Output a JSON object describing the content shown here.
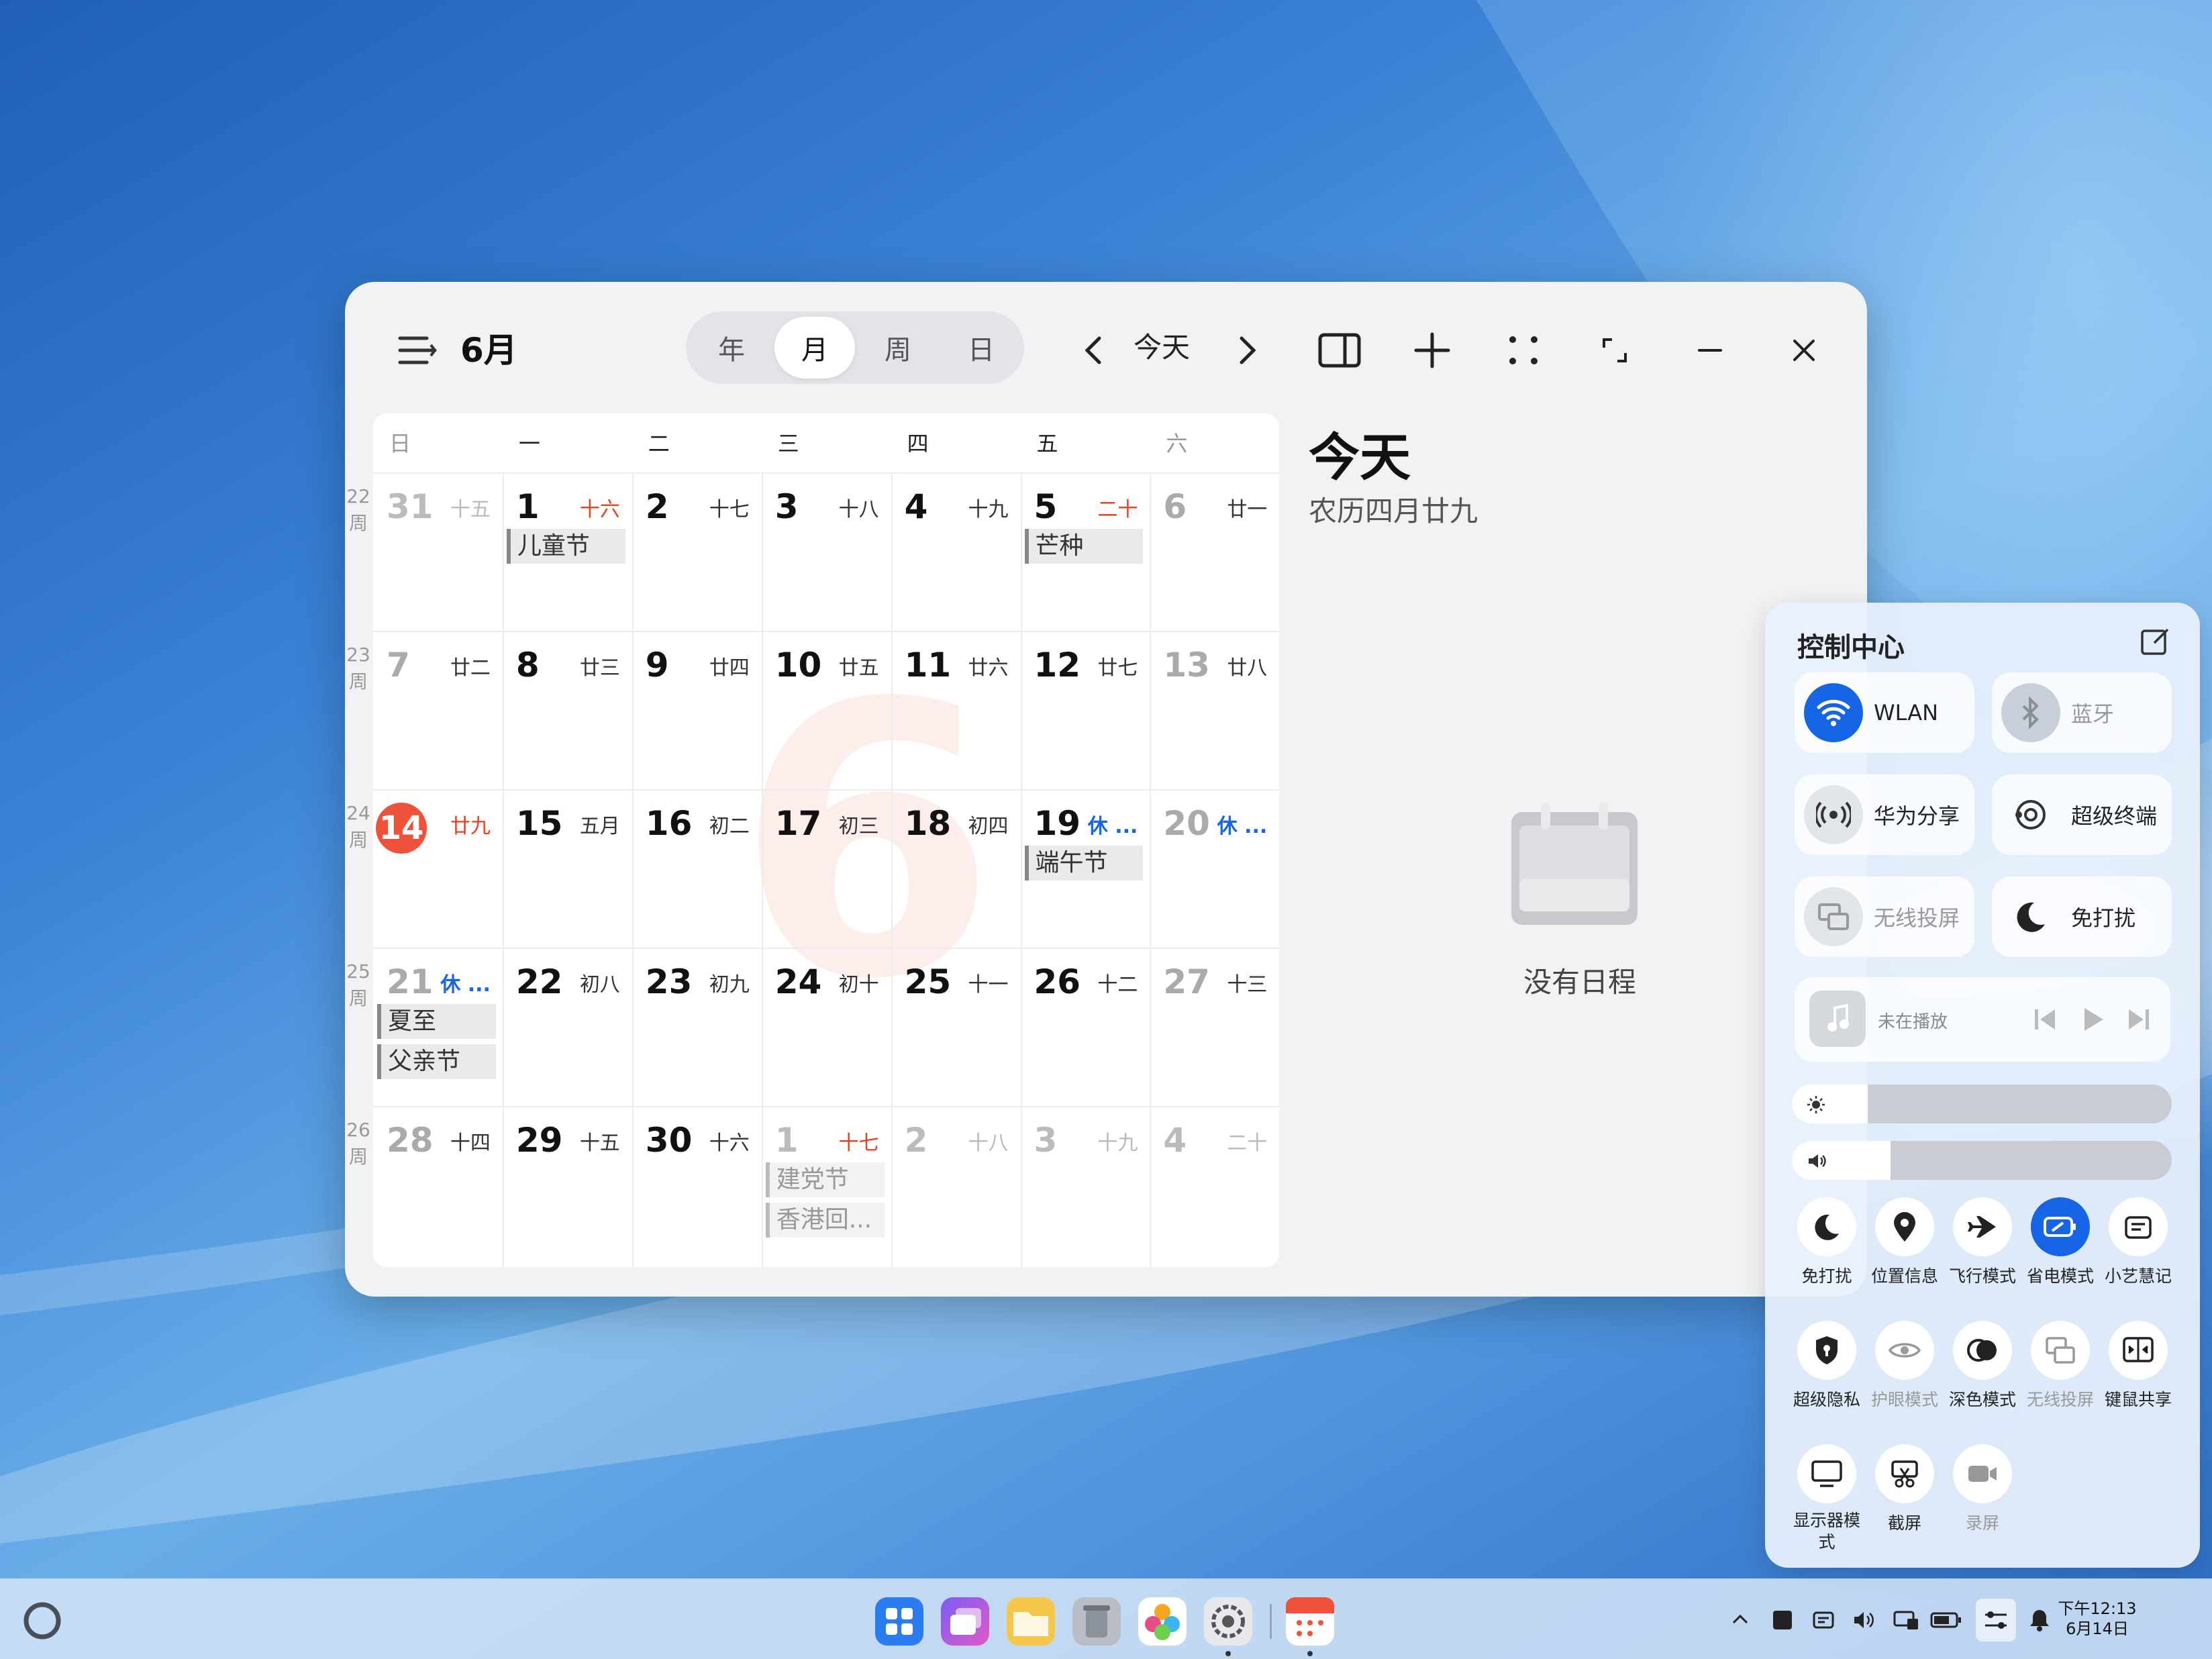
{
  "window": {
    "month_label": "6月",
    "view_tabs": [
      "年",
      "月",
      "周",
      "日"
    ],
    "active_view": "月",
    "today_button": "今天"
  },
  "weekday_headers": [
    "日",
    "一",
    "二",
    "三",
    "四",
    "五",
    "六"
  ],
  "week_numbers": [
    [
      "22",
      "周"
    ],
    [
      "23",
      "周"
    ],
    [
      "24",
      "周"
    ],
    [
      "25",
      "周"
    ],
    [
      "26",
      "周"
    ]
  ],
  "weeks": [
    [
      {
        "d": "31",
        "l": "十五",
        "dim": true
      },
      {
        "d": "1",
        "l": "十六",
        "lc": "red"
      },
      {
        "d": "2",
        "l": "十七"
      },
      {
        "d": "3",
        "l": "十八"
      },
      {
        "d": "4",
        "l": "十九"
      },
      {
        "d": "5",
        "l": "二十",
        "lc": "red"
      },
      {
        "d": "6",
        "l": "廿一",
        "weekend": true
      }
    ],
    [
      {
        "d": "7",
        "l": "廿二",
        "weekend": true
      },
      {
        "d": "8",
        "l": "廿三"
      },
      {
        "d": "9",
        "l": "廿四"
      },
      {
        "d": "10",
        "l": "廿五"
      },
      {
        "d": "11",
        "l": "廿六"
      },
      {
        "d": "12",
        "l": "廿七"
      },
      {
        "d": "13",
        "l": "廿八",
        "weekend": true
      }
    ],
    [
      {
        "d": "14",
        "l": "廿九",
        "lc": "red",
        "today": true
      },
      {
        "d": "15",
        "l": "五月"
      },
      {
        "d": "16",
        "l": "初二"
      },
      {
        "d": "17",
        "l": "初三"
      },
      {
        "d": "18",
        "l": "初四"
      },
      {
        "d": "19",
        "l": "休 ...",
        "lc": "blue"
      },
      {
        "d": "20",
        "l": "休 ...",
        "lc": "blue",
        "weekend": true
      }
    ],
    [
      {
        "d": "21",
        "l": "休 ...",
        "lc": "blue",
        "weekend": true
      },
      {
        "d": "22",
        "l": "初八"
      },
      {
        "d": "23",
        "l": "初九"
      },
      {
        "d": "24",
        "l": "初十"
      },
      {
        "d": "25",
        "l": "十一"
      },
      {
        "d": "26",
        "l": "十二"
      },
      {
        "d": "27",
        "l": "十三",
        "weekend": true
      }
    ],
    [
      {
        "d": "28",
        "l": "十四",
        "weekend": true
      },
      {
        "d": "29",
        "l": "十五"
      },
      {
        "d": "30",
        "l": "十六"
      },
      {
        "d": "1",
        "l": "十七",
        "lc": "red",
        "dim": true
      },
      {
        "d": "2",
        "l": "十八",
        "dim": true
      },
      {
        "d": "3",
        "l": "十九",
        "dim": true
      },
      {
        "d": "4",
        "l": "二十",
        "dim": true
      }
    ]
  ],
  "events": [
    {
      "week": 0,
      "col": 1,
      "slot": 0,
      "title": "儿童节"
    },
    {
      "week": 0,
      "col": 5,
      "slot": 0,
      "title": "芒种"
    },
    {
      "week": 2,
      "col": 5,
      "slot": 0,
      "title": "端午节"
    },
    {
      "week": 3,
      "col": 0,
      "slot": 0,
      "title": "夏至"
    },
    {
      "week": 3,
      "col": 0,
      "slot": 1,
      "title": "父亲节"
    },
    {
      "week": 4,
      "col": 3,
      "slot": 0,
      "title": "建党节",
      "dim": true
    },
    {
      "week": 4,
      "col": 3,
      "slot": 1,
      "title": "香港回...",
      "dim": true
    }
  ],
  "month_watermark": "6",
  "panel": {
    "title": "今天",
    "lunar_date": "农历四月廿九",
    "empty_text": "没有日程"
  },
  "control_center": {
    "title": "控制中心",
    "tiles": [
      "WLAN",
      "蓝牙",
      "华为分享",
      "超级终端",
      "无线投屏",
      "免打扰"
    ],
    "media": {
      "status": "未在播放"
    },
    "brightness": 0.2,
    "volume": 0.26,
    "quick_row1": [
      "免打扰",
      "位置信息",
      "飞行模式",
      "省电模式",
      "小艺慧记"
    ],
    "quick_row2": [
      "超级隐私",
      "护眼模式",
      "深色模式",
      "无线投屏",
      "键鼠共享"
    ],
    "quick_row3": [
      "显示器模式",
      "截屏",
      "录屏"
    ]
  },
  "taskbar": {
    "time": "下午12:13",
    "date": "6月14日"
  },
  "colors": {
    "accent": "#1565e6",
    "today": "#f0513a",
    "holiday": "#e8421c"
  }
}
